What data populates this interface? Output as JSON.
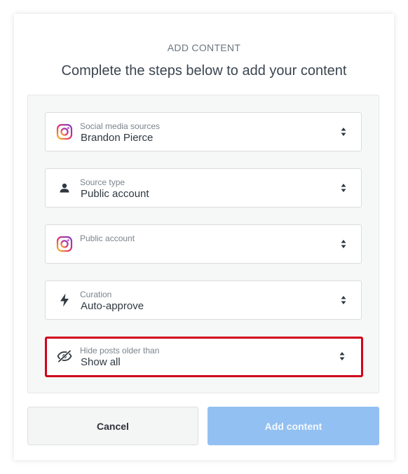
{
  "header": {
    "overline": "ADD CONTENT",
    "title": "Complete the steps below to add your content"
  },
  "fields": [
    {
      "label": "Social media sources",
      "value": "Brandon Pierce",
      "icon": "instagram-icon"
    },
    {
      "label": "Source type",
      "value": "Public account",
      "icon": "person-icon"
    },
    {
      "label": "Public account",
      "value": "",
      "icon": "instagram-icon"
    },
    {
      "label": "Curation",
      "value": "Auto-approve",
      "icon": "lightning-icon"
    },
    {
      "label": "Hide posts older than",
      "value": "Show all",
      "icon": "eye-slash-icon"
    }
  ],
  "buttons": {
    "cancel": "Cancel",
    "add": "Add content"
  },
  "colors": {
    "highlight_border": "#d0021b",
    "primary_disabled": "#93c0f2"
  }
}
